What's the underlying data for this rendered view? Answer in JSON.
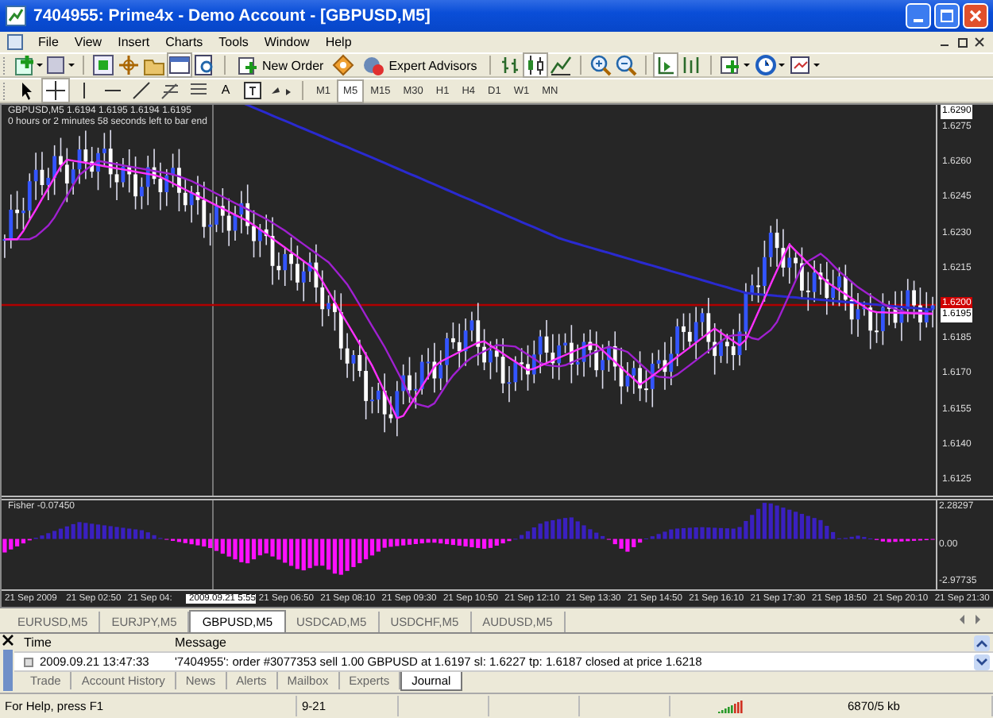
{
  "window": {
    "title": "7404955: Prime4x - Demo Account - [GBPUSD,M5]"
  },
  "menu": [
    "File",
    "View",
    "Insert",
    "Charts",
    "Tools",
    "Window",
    "Help"
  ],
  "toolbar": {
    "new_order": "New Order",
    "expert_advisors": "Expert Advisors"
  },
  "draw_tools": [
    {
      "kind": "cursor",
      "selected": false
    },
    {
      "kind": "crosshair",
      "selected": true
    },
    {
      "kind": "vline",
      "selected": false
    },
    {
      "kind": "hline",
      "selected": false
    },
    {
      "kind": "trend",
      "selected": false
    },
    {
      "kind": "fibo",
      "selected": false
    },
    {
      "kind": "channel",
      "selected": false
    },
    {
      "kind": "text",
      "label": "A",
      "selected": false
    },
    {
      "kind": "label",
      "selected": false
    },
    {
      "kind": "arrows",
      "selected": false
    }
  ],
  "timeframes": [
    {
      "label": "M1",
      "selected": false
    },
    {
      "label": "M5",
      "selected": true
    },
    {
      "label": "M15",
      "selected": false
    },
    {
      "label": "M30",
      "selected": false
    },
    {
      "label": "H1",
      "selected": false
    },
    {
      "label": "H4",
      "selected": false
    },
    {
      "label": "D1",
      "selected": false
    },
    {
      "label": "W1",
      "selected": false
    },
    {
      "label": "MN",
      "selected": false
    }
  ],
  "chart": {
    "symbol_info": "GBPUSD,M5  1.6194 1.6195 1.6194 1.6195",
    "timer": "0 hours or 2 minutes 58 seconds left to bar end",
    "price_axis": [
      {
        "label": "1.6290",
        "kind": "top"
      },
      {
        "label": "1.6275",
        "kind": "plain"
      },
      {
        "label": "1.6260",
        "kind": "plain"
      },
      {
        "label": "1.6245",
        "kind": "plain"
      },
      {
        "label": "1.6230",
        "kind": "plain"
      },
      {
        "label": "1.6215",
        "kind": "plain"
      },
      {
        "label": "1.6200",
        "kind": "line"
      },
      {
        "label": "1.6195",
        "kind": "bid"
      },
      {
        "label": "1.6185",
        "kind": "plain"
      },
      {
        "label": "1.6170",
        "kind": "plain"
      },
      {
        "label": "1.6155",
        "kind": "plain"
      },
      {
        "label": "1.6140",
        "kind": "plain"
      },
      {
        "label": "1.6125",
        "kind": "plain"
      }
    ]
  },
  "indicator": {
    "label": "Fisher -0.07450",
    "axis": [
      "2.28297",
      "0.00",
      "-2.97735"
    ]
  },
  "time_axis": [
    {
      "label": "21 Sep 2009",
      "highlighted": false
    },
    {
      "label": "21 Sep 02:50",
      "highlighted": false
    },
    {
      "label": "21 Sep 04:",
      "highlighted": false
    },
    {
      "label": "2009.09.21 5:55",
      "highlighted": true
    },
    {
      "label": "21 Sep 06:50",
      "highlighted": false
    },
    {
      "label": "21 Sep 08:10",
      "highlighted": false
    },
    {
      "label": "21 Sep 09:30",
      "highlighted": false
    },
    {
      "label": "21 Sep 10:50",
      "highlighted": false
    },
    {
      "label": "21 Sep 12:10",
      "highlighted": false
    },
    {
      "label": "21 Sep 13:30",
      "highlighted": false
    },
    {
      "label": "21 Sep 14:50",
      "highlighted": false
    },
    {
      "label": "21 Sep 16:10",
      "highlighted": false
    },
    {
      "label": "21 Sep 17:30",
      "highlighted": false
    },
    {
      "label": "21 Sep 18:50",
      "highlighted": false
    },
    {
      "label": "21 Sep 20:10",
      "highlighted": false
    },
    {
      "label": "21 Sep 21:30",
      "highlighted": false
    }
  ],
  "symbol_tabs": [
    {
      "label": "EURUSD,M5",
      "selected": false
    },
    {
      "label": "EURJPY,M5",
      "selected": false
    },
    {
      "label": "GBPUSD,M5",
      "selected": true
    },
    {
      "label": "USDCAD,M5",
      "selected": false
    },
    {
      "label": "USDCHF,M5",
      "selected": false
    },
    {
      "label": "AUDUSD,M5",
      "selected": false
    }
  ],
  "terminal": {
    "columns": [
      "Time",
      "Message"
    ],
    "rows": [
      {
        "time": "2009.09.21 13:47:33",
        "message": "'7404955': order #3077353 sell 1.00 GBPUSD at 1.6197 sl: 1.6227 tp: 1.6187 closed at price 1.6218"
      }
    ],
    "tabs": [
      {
        "label": "Trade",
        "selected": false
      },
      {
        "label": "Account History",
        "selected": false
      },
      {
        "label": "News",
        "selected": false
      },
      {
        "label": "Alerts",
        "selected": false
      },
      {
        "label": "Mailbox",
        "selected": false
      },
      {
        "label": "Experts",
        "selected": false
      },
      {
        "label": "Journal",
        "selected": true
      }
    ]
  },
  "status_bar": {
    "help": "For Help, press F1",
    "date": "9-21",
    "traffic": "6870/5 kb"
  }
}
